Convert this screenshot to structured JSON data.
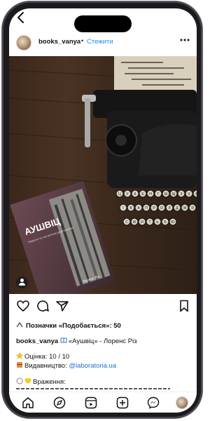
{
  "post": {
    "username": "books_vanya",
    "separator": "•",
    "follow_label": "Стежити",
    "more_label": "•••",
    "likes_label": "Позначки «Подобається»:",
    "likes_count": "50",
    "caption_username": "books_vanya",
    "caption_text": "«Аушвіц» - Лоренс Різ",
    "rating_line": "Оцінка: 10 / 10",
    "publisher_prefix": "Видавництво: ",
    "publisher_link": "@laboratoria.ua",
    "impressions_label": "Враження:"
  },
  "photo": {
    "book_title": "АУШВІЦ",
    "book_subtitle": "Нацисти та «остаточне розв'язання»",
    "book_author": "Лоренс Різ",
    "typewriter_keys": [
      "Ц",
      "У",
      "К",
      "Е",
      "Н",
      "Г",
      "Ш",
      "Щ",
      "З",
      "Х",
      "Ф",
      "І",
      "В",
      "А",
      "П",
      "Р",
      "О",
      "Л",
      "Д",
      "Ж",
      "Я",
      "Ч",
      "С",
      "М",
      "И",
      "Т",
      "Ь",
      "Б",
      "Ю"
    ]
  },
  "colors": {
    "follow": "#1e8bef",
    "link": "#1e6fd0",
    "frame": "#1b1b1e",
    "wood": "#3c2a1e"
  },
  "icons": [
    "back-icon",
    "more-icon",
    "heart-icon",
    "comment-icon",
    "share-icon",
    "bookmark-icon",
    "person-tag-icon",
    "home-icon",
    "explore-icon",
    "reels-icon",
    "create-icon",
    "messenger-icon"
  ]
}
